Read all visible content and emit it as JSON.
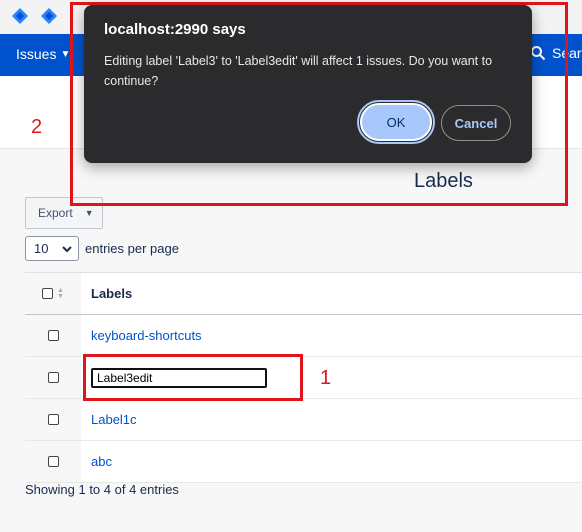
{
  "nav": {
    "issues_label": "Issues",
    "search_label": "Search"
  },
  "page": {
    "title": "Labels"
  },
  "toolbar": {
    "export_label": "Export",
    "page_length_value": "10",
    "page_length_suffix": "entries per page"
  },
  "table": {
    "header": "Labels",
    "rows": [
      {
        "label": "keyboard-shortcuts"
      },
      {
        "label": "",
        "edit_value": "Label3edit"
      },
      {
        "label": "Label1c"
      },
      {
        "label": "abc"
      }
    ]
  },
  "footer": {
    "info": "Showing 1 to 4 of 4 entries"
  },
  "dialog": {
    "title": "localhost:2990 says",
    "message": "Editing label 'Label3' to 'Label3edit' will affect 1 issues. Do you want to continue?",
    "ok_label": "OK",
    "cancel_label": "Cancel"
  },
  "annotations": {
    "box1_number": "1",
    "box2_number": "2"
  },
  "colors": {
    "nav_blue": "#0052cc",
    "link_blue": "#0052cc",
    "annotation_red": "#e0151b",
    "dialog_bg": "#2b2b2e",
    "ok_button": "#a8c7fa"
  }
}
